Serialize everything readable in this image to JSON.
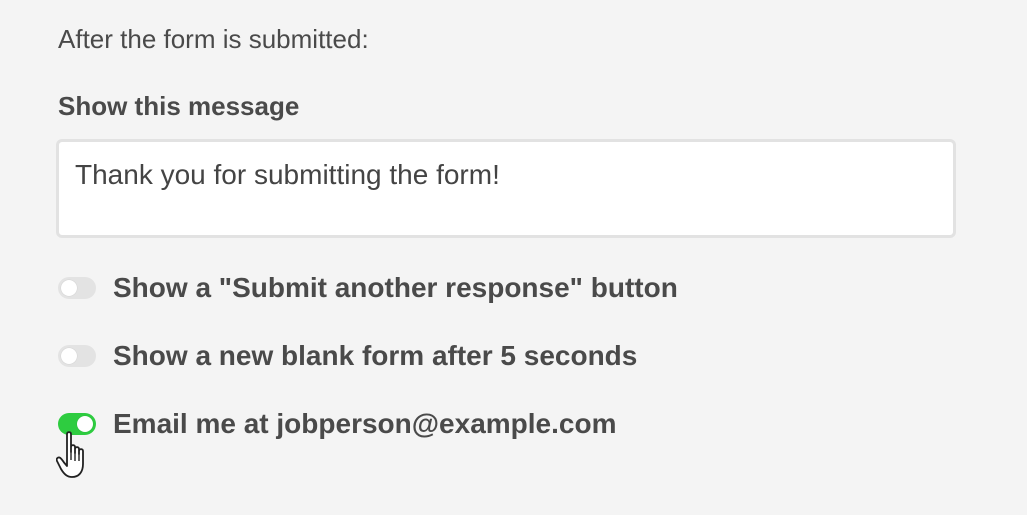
{
  "form": {
    "intro": "After the form is submitted:",
    "message_label": "Show this message",
    "message_value": "Thank you for submitting the form!"
  },
  "options": [
    {
      "label": "Show a \"Submit another response\" button",
      "enabled": false
    },
    {
      "label": "Show a new blank form after 5 seconds",
      "enabled": false
    },
    {
      "label": "Email me at jobperson@example.com",
      "enabled": true
    }
  ],
  "colors": {
    "toggle_on": "#2ecc40",
    "toggle_off": "#e3e3e3",
    "background": "#f4f4f4"
  },
  "icons": {
    "cursor": "hand-pointer-icon"
  }
}
